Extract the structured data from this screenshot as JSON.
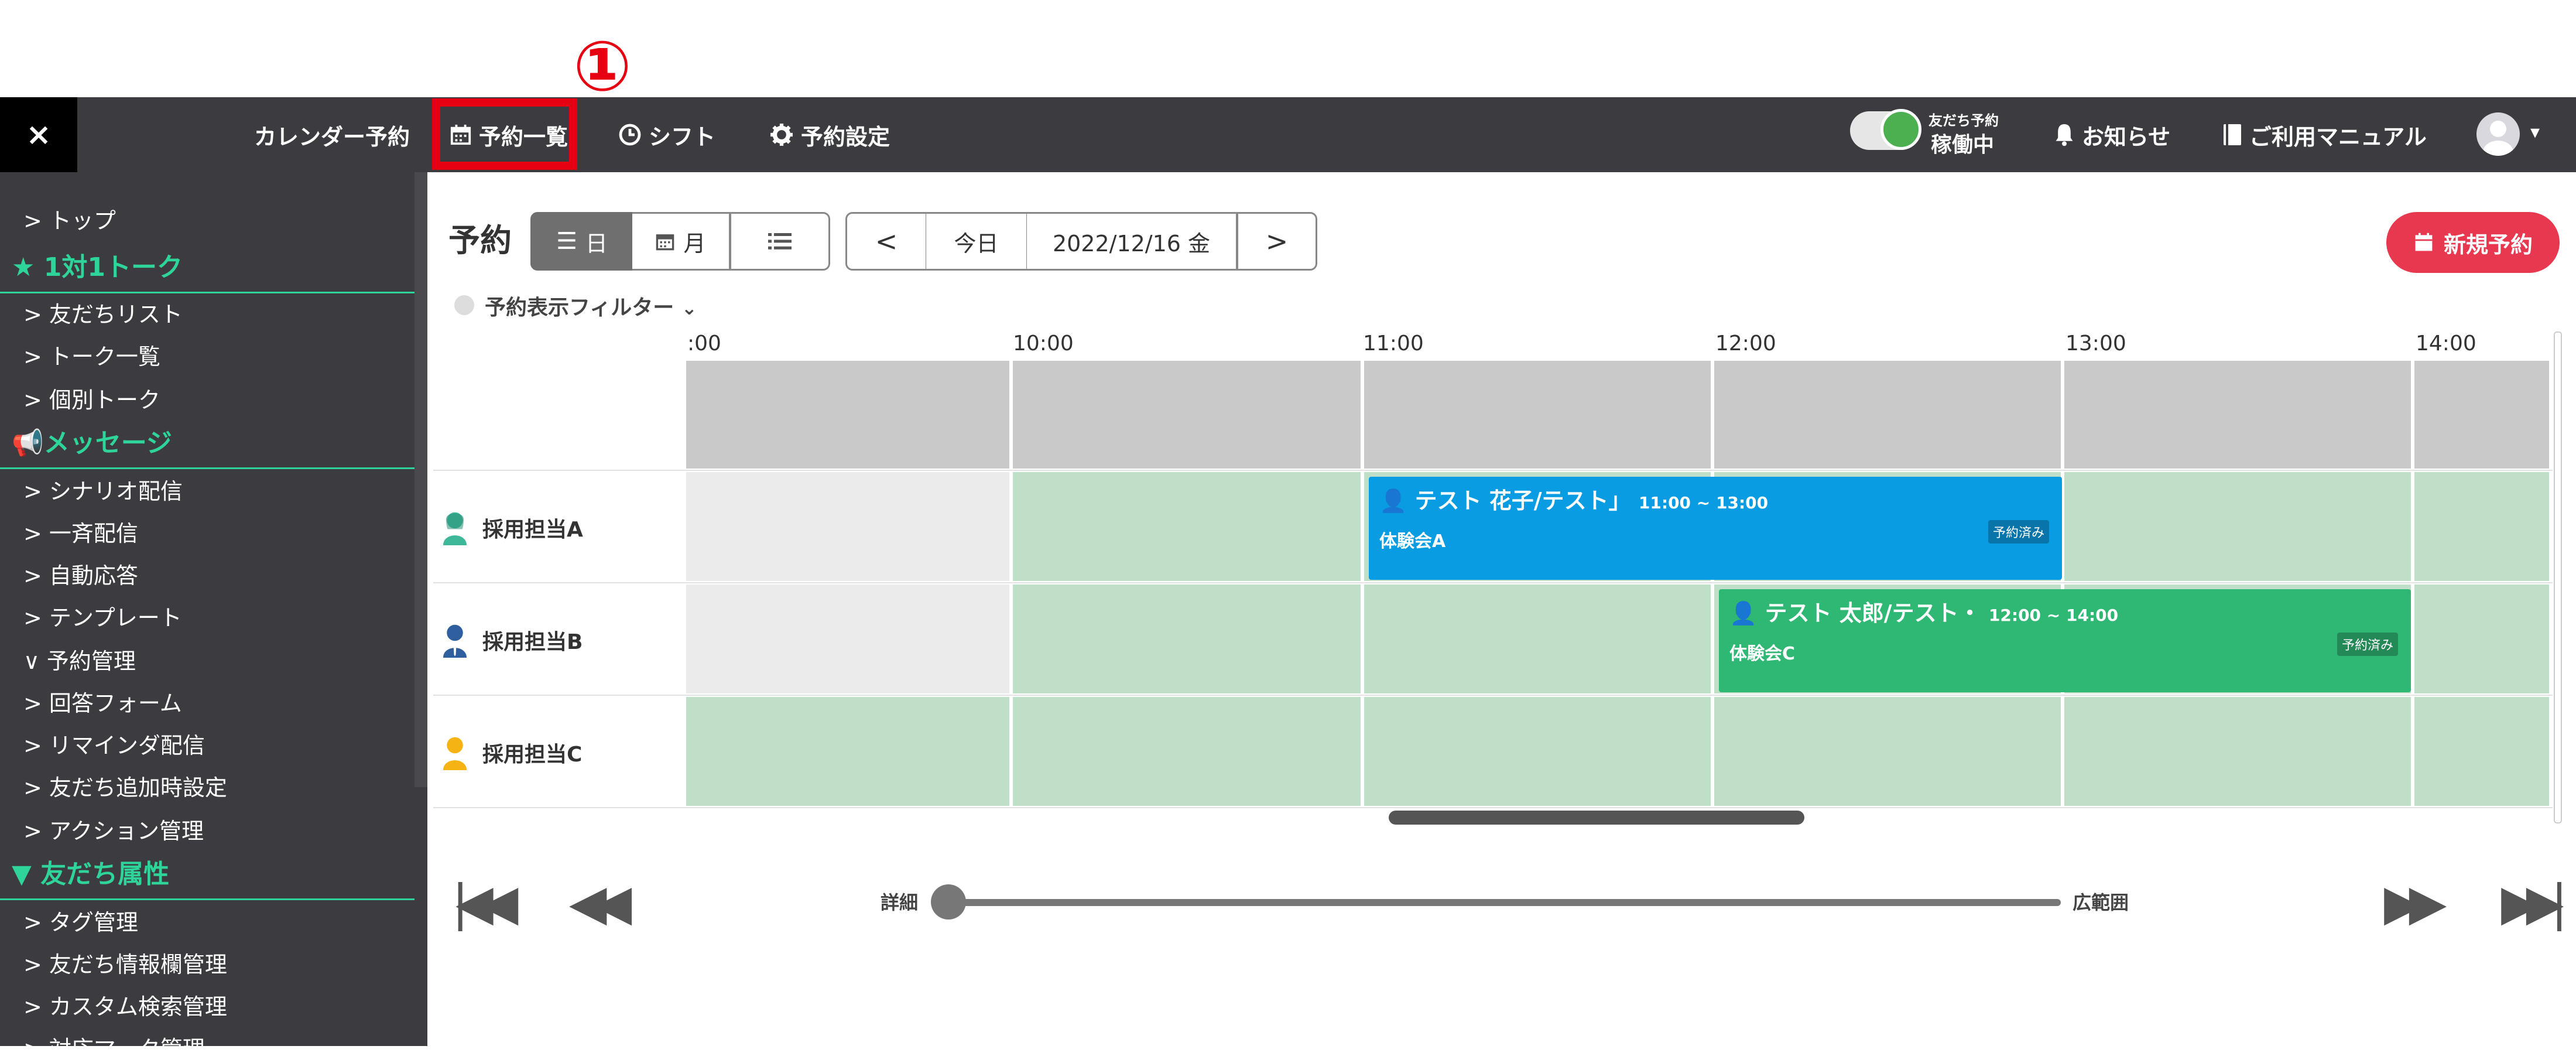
{
  "annotation": {
    "number": "①"
  },
  "header": {
    "close": "×",
    "calendar": "カレンダー予約",
    "reservation_list": "予約一覧",
    "shift": "シフト",
    "settings": "予約設定",
    "toggle_label_small": "友だち予約",
    "toggle_status": "稼働中",
    "news": "お知らせ",
    "manual": "ご利用マニュアル"
  },
  "sidebar": {
    "top": "> トップ",
    "sec1": "1対1トーク",
    "s1": [
      "> 友だちリスト",
      "> トーク一覧",
      "> 個別トーク"
    ],
    "sec2": "メッセージ",
    "s2": [
      "> シナリオ配信",
      "> 一斉配信",
      "> 自動応答",
      "> テンプレート",
      "∨ 予約管理",
      "> 回答フォーム",
      "> リマインダ配信",
      "> 友だち追加時設定",
      "> アクション管理"
    ],
    "sec3": "友だち属性",
    "s3": [
      "> タグ管理",
      "> 友だち情報欄管理",
      "> カスタム検索管理",
      "> 対応マーク管理"
    ]
  },
  "toolbar": {
    "title": "予約",
    "day": "日",
    "month": "月",
    "prev": "<",
    "today": "今日",
    "date": "2022/12/16 金",
    "next": ">",
    "new": "新規予約",
    "filter": "予約表示フィルター"
  },
  "times": [
    ":00",
    "10:00",
    "11:00",
    "12:00",
    "13:00",
    "14:00"
  ],
  "rows": [
    "採用担当A",
    "採用担当B",
    "採用担当C"
  ],
  "events": [
    {
      "title": "テスト 花子/テスト」",
      "time": "11:00 ~ 13:00",
      "sub": "体験会A",
      "badge": "予約済み",
      "color": "#0a9ce3"
    },
    {
      "title": "テスト 太郎/テスト・",
      "time": "12:00 ~ 14:00",
      "sub": "体験会C",
      "badge": "予約済み",
      "color": "#2fb774"
    }
  ],
  "zoom": {
    "left": "詳細",
    "right": "広範囲"
  },
  "colors": {
    "header_bg": "#3c3c40",
    "accent": "#2fd49a",
    "highlight": "#e60012",
    "slot_green": "#bfdfc8",
    "slot_gray": "#c9c9c9",
    "new_btn": "#e8384f"
  }
}
